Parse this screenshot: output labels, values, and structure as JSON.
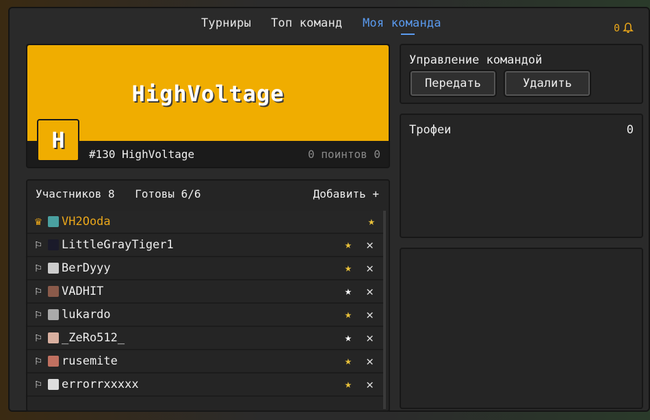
{
  "nav": {
    "tabs": [
      {
        "label": "Турниры"
      },
      {
        "label": "Топ команд"
      },
      {
        "label": "Моя команда"
      }
    ],
    "notifications_count": "0"
  },
  "team": {
    "name": "HighVoltage",
    "logo_letter": "H",
    "rank_text": "#130 HighVoltage",
    "points_text": "0 поинтов 0",
    "accent_color": "#f0ad00"
  },
  "members": {
    "count_label": "Участников 8",
    "ready_label": "Готовы 6/6",
    "add_label": "Добавить +",
    "list": [
      {
        "name": "VH2Ooda",
        "role_icon": "♛",
        "star": "★",
        "star_color": "#e9c13a",
        "avatar_color": "#4aa0a0",
        "kick": ""
      },
      {
        "name": "LittleGrayTiger1",
        "role_icon": "⚐",
        "star": "★",
        "star_color": "#e9c13a",
        "avatar_color": "#1a1a2a",
        "kick": "✕"
      },
      {
        "name": "BerDyyy",
        "role_icon": "⚐",
        "star": "★",
        "star_color": "#e9c13a",
        "avatar_color": "#cccccc",
        "kick": "✕"
      },
      {
        "name": "VADHIT",
        "role_icon": "⚐",
        "star": "★",
        "star_color": "#ffffff",
        "avatar_color": "#8a5a4a",
        "kick": "✕"
      },
      {
        "name": "lukardo",
        "role_icon": "⚐",
        "star": "★",
        "star_color": "#e9c13a",
        "avatar_color": "#aaaaaa",
        "kick": "✕"
      },
      {
        "name": "_ZeRo512_",
        "role_icon": "⚐",
        "star": "★",
        "star_color": "#ffffff",
        "avatar_color": "#d9b0a0",
        "kick": "✕"
      },
      {
        "name": "rusemite",
        "role_icon": "⚐",
        "star": "★",
        "star_color": "#e9c13a",
        "avatar_color": "#c07060",
        "kick": "✕"
      },
      {
        "name": "errorrxxxxx",
        "role_icon": "⚐",
        "star": "★",
        "star_color": "#e9c13a",
        "avatar_color": "#dddddd",
        "kick": "✕"
      }
    ]
  },
  "management": {
    "title": "Управление командой",
    "transfer_label": "Передать",
    "delete_label": "Удалить"
  },
  "trophies": {
    "title": "Трофеи",
    "count": "0"
  }
}
